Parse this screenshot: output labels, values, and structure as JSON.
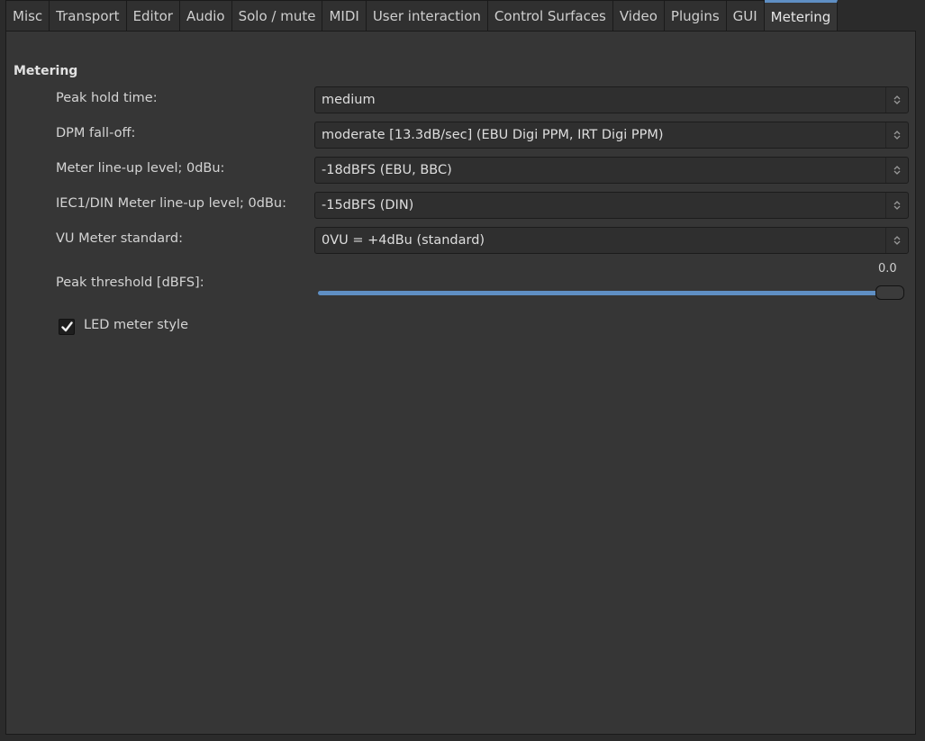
{
  "tabs": [
    {
      "label": "Misc",
      "active": false
    },
    {
      "label": "Transport",
      "active": false
    },
    {
      "label": "Editor",
      "active": false
    },
    {
      "label": "Audio",
      "active": false
    },
    {
      "label": "Solo / mute",
      "active": false
    },
    {
      "label": "MIDI",
      "active": false
    },
    {
      "label": "User interaction",
      "active": false
    },
    {
      "label": "Control Surfaces",
      "active": false
    },
    {
      "label": "Video",
      "active": false
    },
    {
      "label": "Plugins",
      "active": false
    },
    {
      "label": "GUI",
      "active": false
    },
    {
      "label": "Metering",
      "active": true
    }
  ],
  "section": {
    "title": "Metering"
  },
  "settings": [
    {
      "label": "Peak hold time:",
      "value": "medium"
    },
    {
      "label": "DPM fall-off:",
      "value": "moderate [13.3dB/sec] (EBU Digi PPM, IRT Digi PPM)"
    },
    {
      "label": "Meter line-up level; 0dBu:",
      "value": "-18dBFS (EBU, BBC)"
    },
    {
      "label": "IEC1/DIN Meter line-up level; 0dBu:",
      "value": "-15dBFS (DIN)"
    },
    {
      "label": "VU Meter standard:",
      "value": "0VU = +4dBu (standard)"
    }
  ],
  "peak_threshold": {
    "label": "Peak threshold [dBFS]:",
    "value_text": "0.0",
    "fraction": 1.0
  },
  "led_meter": {
    "label": "LED meter style",
    "checked": true
  },
  "colors": {
    "accent": "#5f8fc4",
    "background": "#363636"
  }
}
